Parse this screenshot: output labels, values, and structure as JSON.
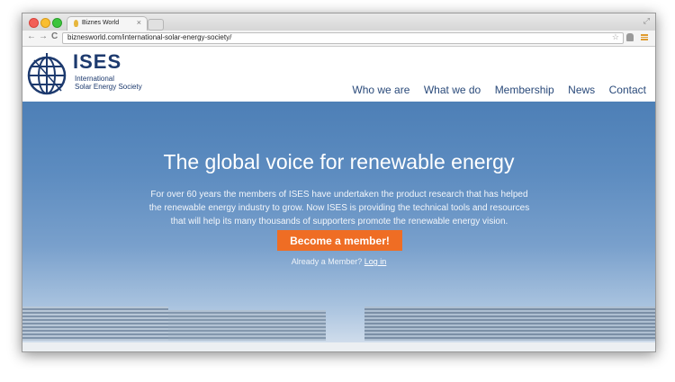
{
  "browser": {
    "tab_title": "Biznes World",
    "tab_close": "×",
    "back": "←",
    "forward": "→",
    "reload": "C",
    "url": "biznesworld.com/international-solar-energy-society/",
    "bookmark_star": "☆",
    "fullscreen": "⤢"
  },
  "site": {
    "brand": "ISES",
    "tagline_line1": "International",
    "tagline_line2": "Solar Energy Society",
    "nav": [
      "Who we are",
      "What we do",
      "Membership",
      "News",
      "Contact"
    ]
  },
  "hero": {
    "title": "The global voice for renewable energy",
    "text": "For over 60 years the members of ISES have undertaken the product research that has helped the renewable energy industry to grow. Now ISES is providing the technical tools and resources that will help its many thousands of supporters promote the renewable energy vision.",
    "cta": "Become a member!",
    "already_text": "Already a Member?",
    "login": "Log in"
  },
  "icons": [
    "close-icon",
    "back-icon",
    "forward-icon",
    "reload-icon",
    "star-icon",
    "extension-icon",
    "menu-icon",
    "globe-logo-icon",
    "favicon-icon",
    "fullscreen-icon"
  ],
  "colors": {
    "brand": "#1d3a6e",
    "cta": "#ef6d24",
    "hero_sky": "#5d8cc0",
    "nav_link": "#2a4a7a"
  }
}
